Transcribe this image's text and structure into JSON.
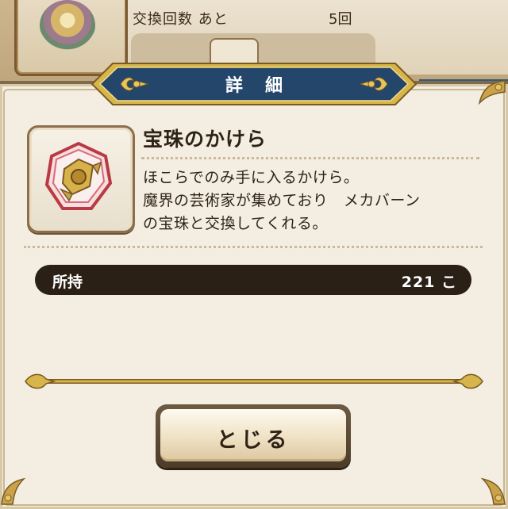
{
  "background": {
    "exchange_label": "交換回数 あと",
    "exchange_count": "5回"
  },
  "dialog": {
    "title": "詳細",
    "item": {
      "name": "宝珠のかけら",
      "description_lines": [
        "ほこらでのみ手に入るかけら。",
        "魔界の芸術家が集めており　メカバーン",
        "の宝珠と交換してくれる。"
      ]
    },
    "possession": {
      "label": "所持",
      "value": "221 こ"
    },
    "close_button": "とじる"
  },
  "colors": {
    "banner_blue": "#24466a",
    "banner_gold": "#d8b54a",
    "dialog_bg": "#f4eee2",
    "possess_bar": "#2b2016",
    "text_dark": "#2f2316"
  },
  "icons": {
    "item": "orb-shard-icon",
    "banner_left": "fleur-de-lis-icon",
    "banner_right": "fleur-de-lis-icon",
    "background_medal": "medal-icon"
  }
}
